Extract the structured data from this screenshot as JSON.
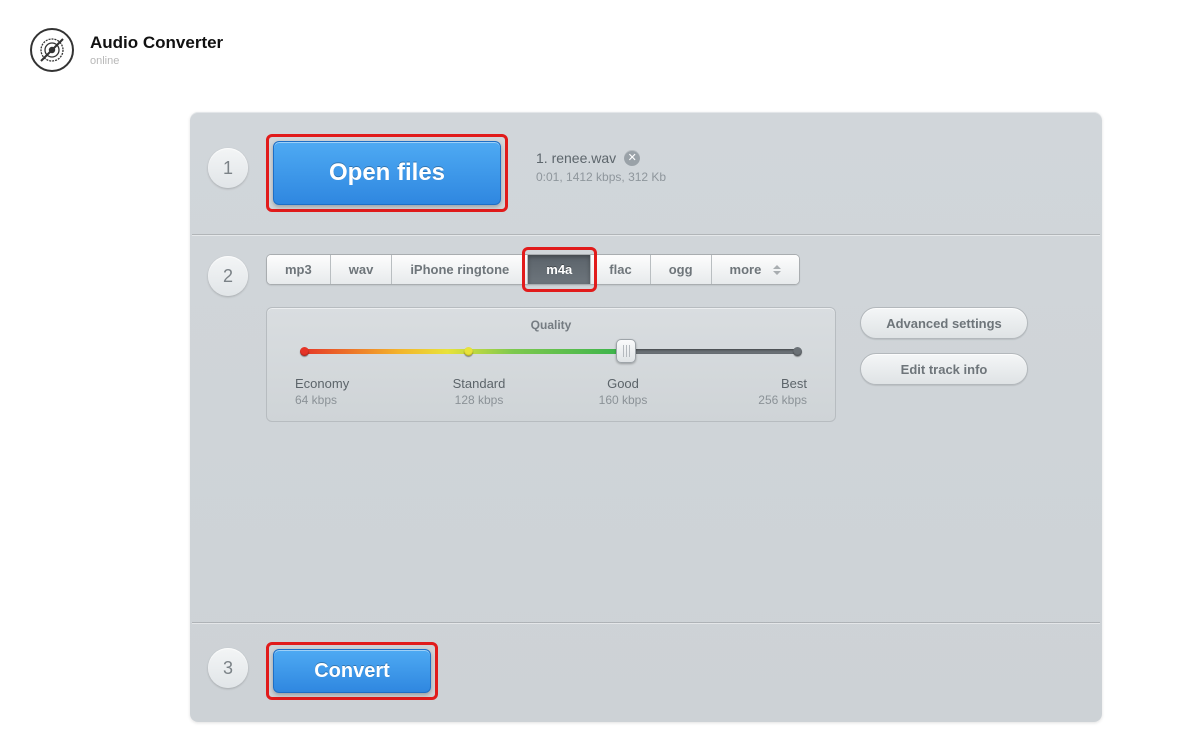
{
  "header": {
    "title": "Audio Converter",
    "subtitle": "online"
  },
  "steps": {
    "s1": "1",
    "s2": "2",
    "s3": "3"
  },
  "open_button_label": "Open files",
  "file": {
    "line": "1. renee.wav",
    "meta": "0:01, 1412 kbps, 312 Kb"
  },
  "formats": {
    "mp3": "mp3",
    "wav": "wav",
    "iphone": "iPhone ringtone",
    "m4a": "m4a",
    "flac": "flac",
    "ogg": "ogg",
    "more": "more"
  },
  "quality": {
    "title": "Quality",
    "ticks": [
      {
        "label": "Economy",
        "bitrate": "64 kbps"
      },
      {
        "label": "Standard",
        "bitrate": "128 kbps"
      },
      {
        "label": "Good",
        "bitrate": "160 kbps"
      },
      {
        "label": "Best",
        "bitrate": "256 kbps"
      }
    ]
  },
  "side": {
    "advanced": "Advanced settings",
    "edit": "Edit track info"
  },
  "convert_label": "Convert"
}
